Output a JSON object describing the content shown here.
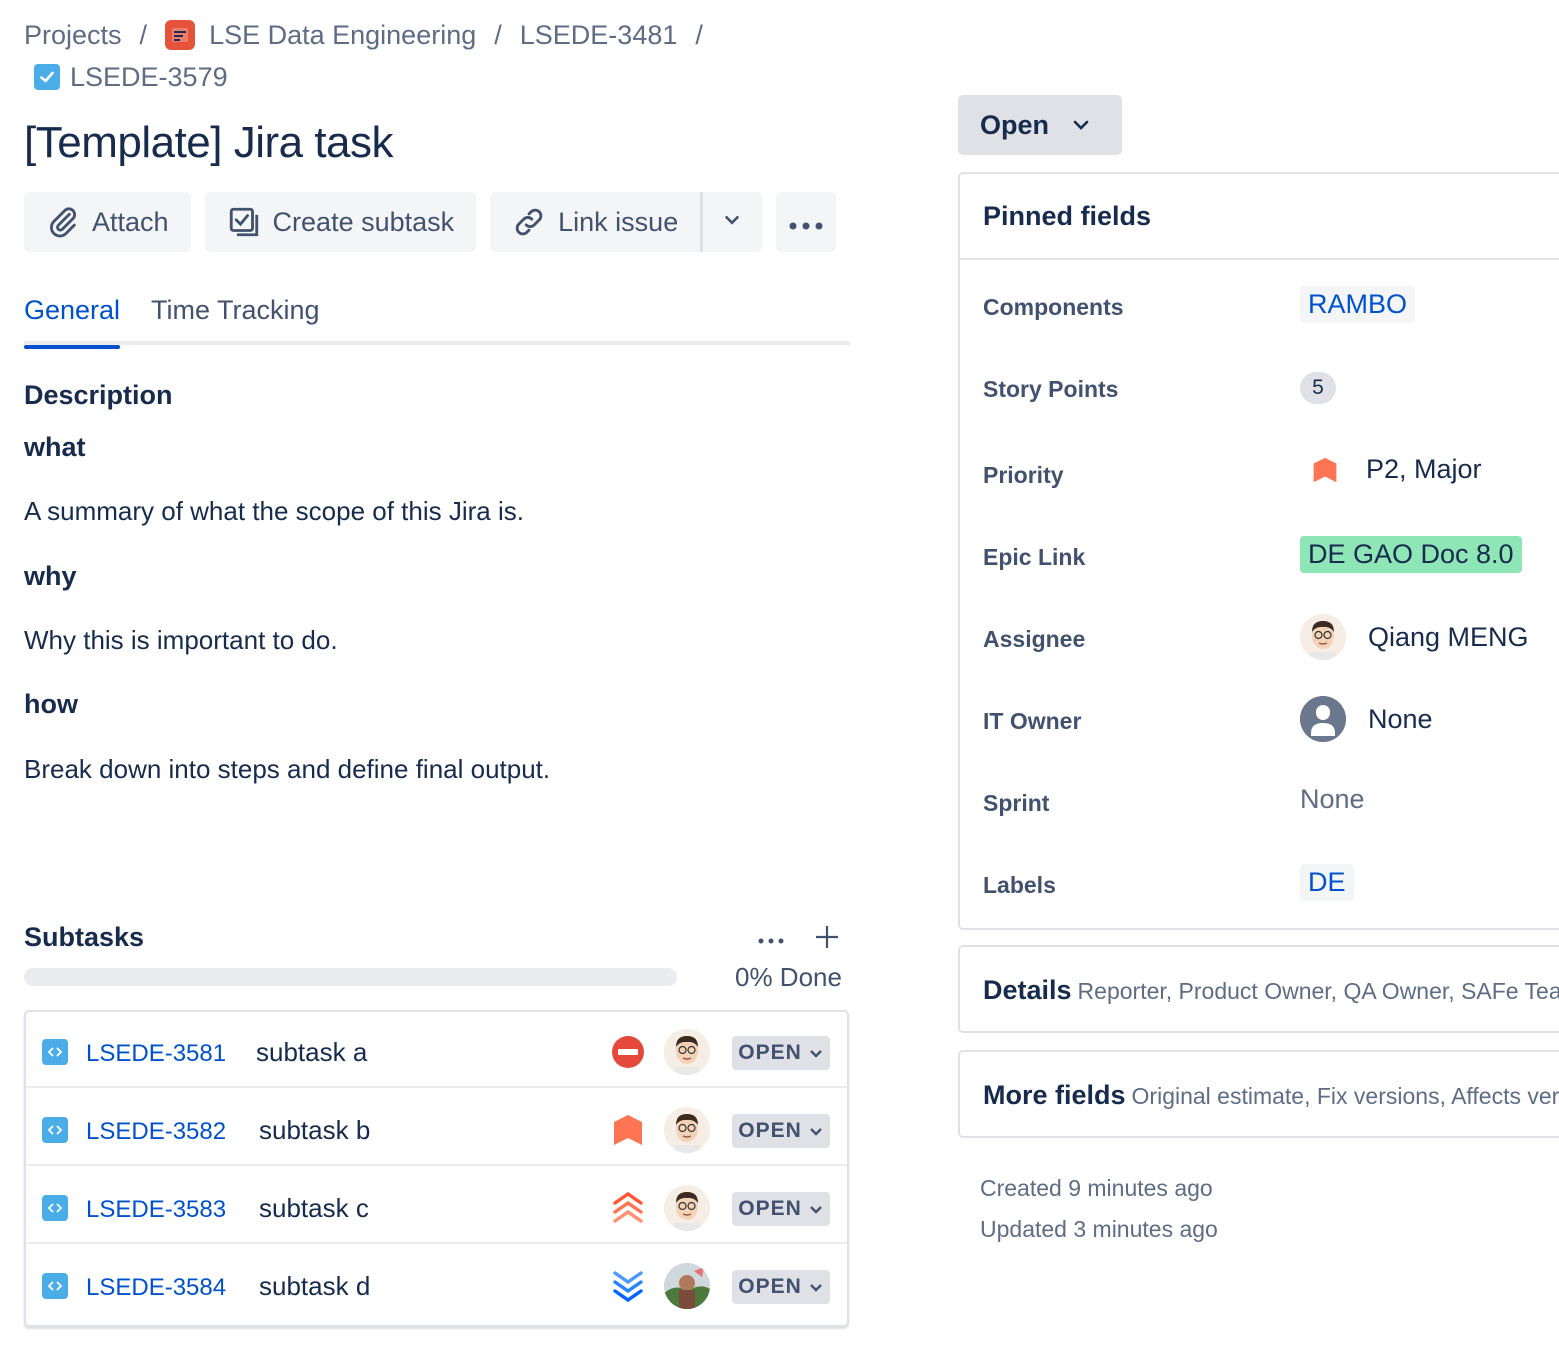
{
  "breadcrumb": {
    "projects": "Projects",
    "project": "LSE Data Engineering",
    "parent": "LSEDE-3481",
    "current": "LSEDE-3579",
    "separator": "/"
  },
  "issue": {
    "title": "[Template] Jira task"
  },
  "toolbar": {
    "attach": "Attach",
    "create_subtask": "Create subtask",
    "link_issue": "Link issue"
  },
  "tabs": [
    {
      "label": "General",
      "active": true
    },
    {
      "label": "Time Tracking",
      "active": false
    }
  ],
  "description": {
    "heading": "Description",
    "what_h": "what",
    "what_p": "A summary of what the scope of this Jira is.",
    "why_h": "why",
    "why_p": "Why this is important to do.",
    "how_h": "how",
    "how_p": "Break down into steps and define final output."
  },
  "subtasks": {
    "heading": "Subtasks",
    "progress_percent": 0,
    "progress_label": "0% Done",
    "items": [
      {
        "key": "LSEDE-3581",
        "summary": "subtask a",
        "priority": "blocker",
        "priority_icon": "blocker-icon",
        "status": "OPEN"
      },
      {
        "key": "LSEDE-3582",
        "summary": "subtask b",
        "priority": "major",
        "priority_icon": "major-priority-icon",
        "status": "OPEN"
      },
      {
        "key": "LSEDE-3583",
        "summary": "subtask c",
        "priority": "highest",
        "priority_icon": "highest-priority-icon",
        "status": "OPEN"
      },
      {
        "key": "LSEDE-3584",
        "summary": "subtask d",
        "priority": "lowest",
        "priority_icon": "lowest-priority-icon",
        "status": "OPEN"
      }
    ]
  },
  "status_button": {
    "label": "Open"
  },
  "pinned": {
    "heading": "Pinned fields",
    "components_label": "Components",
    "components_value": "RAMBO",
    "story_points_label": "Story Points",
    "story_points_value": "5",
    "priority_label": "Priority",
    "priority_value": "P2, Major",
    "epic_label": "Epic Link",
    "epic_value": "DE GAO Doc 8.0",
    "assignee_label": "Assignee",
    "assignee_value": "Qiang MENG",
    "it_owner_label": "IT Owner",
    "it_owner_value": "None",
    "sprint_label": "Sprint",
    "sprint_value": "None",
    "labels_label": "Labels",
    "labels_value": "DE"
  },
  "details": {
    "title": "Details",
    "summary": "Reporter, Product Owner, QA Owner, SAFe Team"
  },
  "more_fields": {
    "title": "More fields",
    "summary": "Original estimate, Fix versions, Affects versions"
  },
  "meta": {
    "created": "Created 9 minutes ago",
    "updated": "Updated 3 minutes ago"
  },
  "colors": {
    "link_blue": "#0052cc",
    "priority_orange": "#ff7452",
    "blocker_red": "#e5493a",
    "lowest_blue": "#2684ff",
    "epic_green": "#8ee5b5",
    "task_blue": "#4bade8"
  }
}
